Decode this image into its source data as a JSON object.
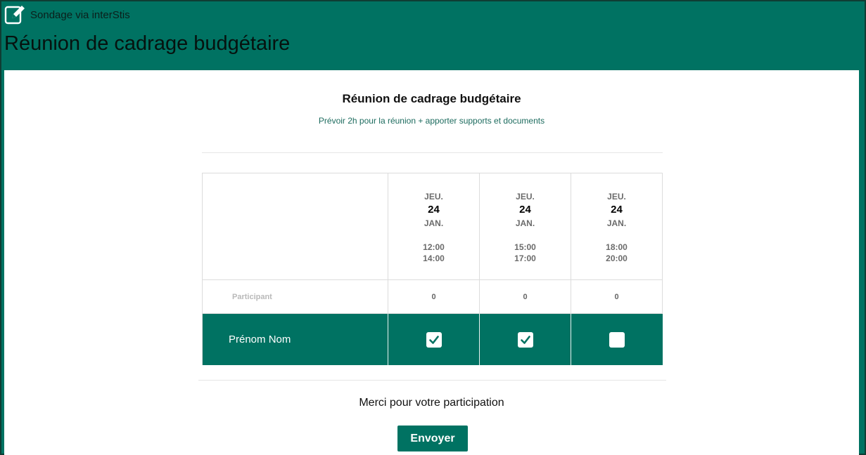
{
  "header": {
    "brand": "Sondage via interStis",
    "page_title": "Réunion de cadrage budgétaire",
    "logo_icon": "edit-note-icon"
  },
  "poll": {
    "title": "Réunion de cadrage budgétaire",
    "description": "Prévoir 2h pour la réunion + apporter supports et documents"
  },
  "options": [
    {
      "dow": "JEU.",
      "day": "24",
      "month": "JAN.",
      "start": "12:00",
      "end": "14:00",
      "count": "0",
      "checked": true
    },
    {
      "dow": "JEU.",
      "day": "24",
      "month": "JAN.",
      "start": "15:00",
      "end": "17:00",
      "count": "0",
      "checked": true
    },
    {
      "dow": "JEU.",
      "day": "24",
      "month": "JAN.",
      "start": "18:00",
      "end": "20:00",
      "count": "0",
      "checked": false
    }
  ],
  "participants_label": "Participant",
  "voter_name": "Prénom Nom",
  "footer": {
    "thanks": "Merci pour votre participation",
    "submit_label": "Envoyer"
  },
  "colors": {
    "brand": "#007262",
    "white": "#ffffff"
  }
}
